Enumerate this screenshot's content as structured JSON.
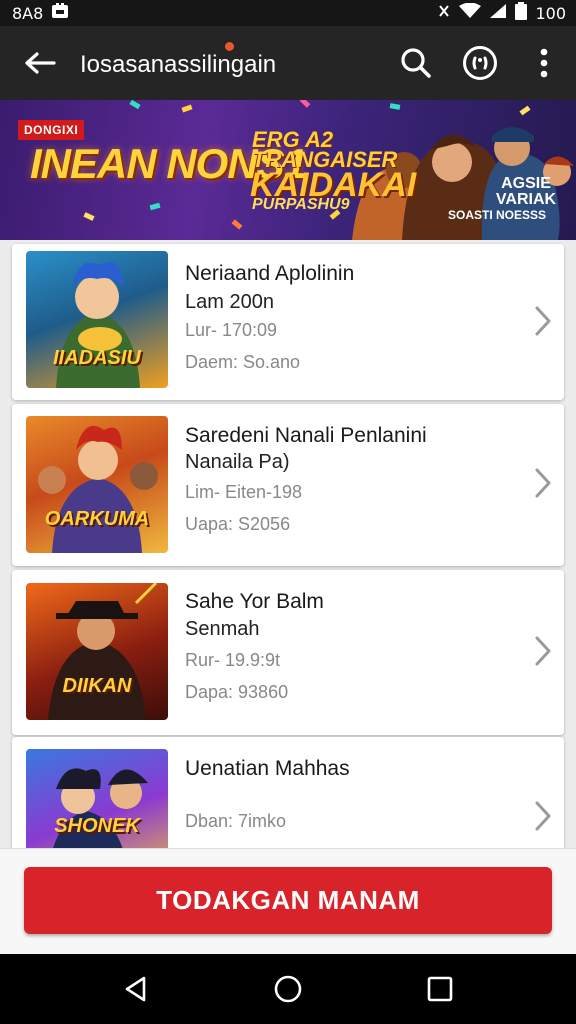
{
  "status_bar": {
    "time": "8A8",
    "battery": "100"
  },
  "app_bar": {
    "title": "Iosasanassilingain"
  },
  "banner": {
    "tag": "DONGIXI",
    "headline": "INEAN NONS1",
    "tagline": "ERG A2 TRANGAISER",
    "subtitle": "KAIDAKAI",
    "small": "PURPASHU9",
    "right_label": "AGSIE VARIAK",
    "right_small": "SOASTI NOESSS"
  },
  "games": [
    {
      "title": "Neriaand Aplolinin",
      "subtitle": "Lam 200n",
      "line1": "Lur- 170:09",
      "line2": "Daem: So.ano",
      "thumb_label": "IIADASIU"
    },
    {
      "title": "Saredeni Nanali Penlanini",
      "subtitle": "Nanaila Pa)",
      "line1": "Lim- Eiten-198",
      "line2": "Uapa: S2056",
      "thumb_label": "OARKUMA"
    },
    {
      "title": "Sahe Yor Balm",
      "subtitle": "Senmah",
      "line1": "Rur- 19.9:9t",
      "line2": "Dapa: 93860",
      "thumb_label": "DIIKAN"
    },
    {
      "title": "Uenatian Mahhas",
      "subtitle": "",
      "line1": "",
      "line2": "Dban: 7imko",
      "thumb_label": "SHONEK"
    }
  ],
  "cta": {
    "label": "TODAKGAN MANAM"
  },
  "colors": {
    "accent": "#d8232a",
    "app_bar": "#252525",
    "status_bar": "#161616"
  }
}
